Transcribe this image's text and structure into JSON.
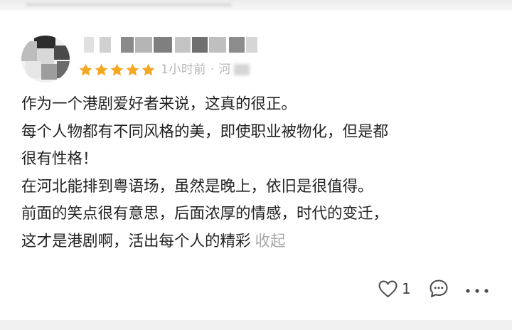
{
  "review": {
    "rating": 5,
    "rating_max": 5,
    "time": "1小时前 · 河",
    "content_lines": [
      "作为一个港剧爱好者来说，这真的很正。",
      "每个人物都有不同风格的美，即使职业被物化，但是都",
      "很有性格！",
      "在河北能排到粤语场，虽然是晚上，依旧是很值得。",
      "前面的笑点很有意思，后面浓厚的情感，时代的变迁，",
      "这才是港剧啊，活出每个人的精彩"
    ],
    "collapse_label": "收起"
  },
  "actions": {
    "like_count": "1",
    "like_icon": "heart-outline-icon",
    "comment_icon": "comment-bubble-icon",
    "more_icon": "more-dots-icon"
  },
  "colors": {
    "star": "#F5A623",
    "text": "#222222",
    "muted": "#A8A8A8",
    "background": "#F1F1F1",
    "card": "#FFFFFF"
  }
}
